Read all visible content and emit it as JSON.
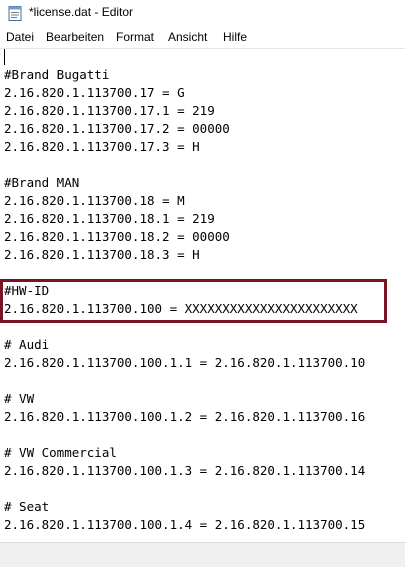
{
  "window": {
    "title": "*license.dat - Editor",
    "icon": "notepad-icon"
  },
  "menu": {
    "items": [
      {
        "label": "Datei"
      },
      {
        "label": "Bearbeiten"
      },
      {
        "label": "Format"
      },
      {
        "label": "Ansicht"
      },
      {
        "label": "Hilfe"
      }
    ]
  },
  "editor": {
    "lines": [
      "#Brand Bugatti",
      "2.16.820.1.113700.17 = G",
      "2.16.820.1.113700.17.1 = 219",
      "2.16.820.1.113700.17.2 = 00000",
      "2.16.820.1.113700.17.3 = H",
      "#Brand MAN",
      "2.16.820.1.113700.18 = M",
      "2.16.820.1.113700.18.1 = 219",
      "2.16.820.1.113700.18.2 = 00000",
      "2.16.820.1.113700.18.3 = H",
      "#HW-ID",
      "2.16.820.1.113700.100 = XXXXXXXXXXXXXXXXXXXXXXX",
      "# Audi",
      "2.16.820.1.113700.100.1.1 = 2.16.820.1.113700.10",
      "# VW",
      "2.16.820.1.113700.100.1.2 = 2.16.820.1.113700.16",
      "# VW Commercial",
      "2.16.820.1.113700.100.1.3 = 2.16.820.1.113700.14",
      "# Seat",
      "2.16.820.1.113700.100.1.4 = 2.16.820.1.113700.15"
    ],
    "highlight_color": "#7a1424"
  }
}
